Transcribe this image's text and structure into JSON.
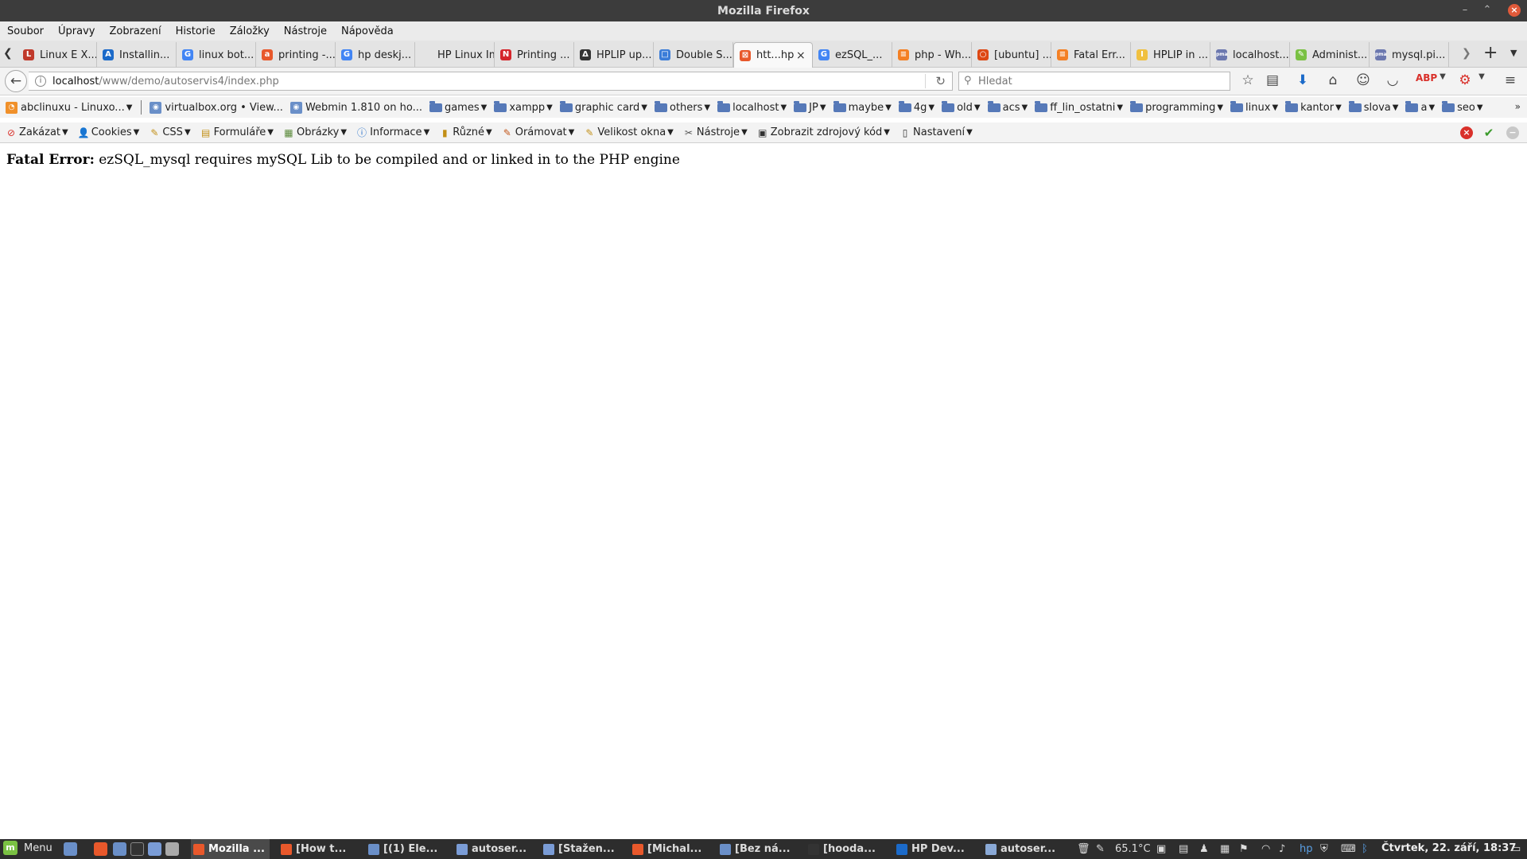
{
  "window": {
    "title": "Mozilla Firefox"
  },
  "menubar": [
    "Soubor",
    "Úpravy",
    "Zobrazení",
    "Historie",
    "Záložky",
    "Nástroje",
    "Nápověda"
  ],
  "tabs": [
    {
      "label": "Linux E X...",
      "color": "#c0392b",
      "glyph": "L"
    },
    {
      "label": "Installin...",
      "color": "#1b6ac9",
      "glyph": "A"
    },
    {
      "label": "linux bot...",
      "color": "#4285f4",
      "glyph": "G"
    },
    {
      "label": "printing -...",
      "color": "#e8582b",
      "glyph": "a"
    },
    {
      "label": "hp deskj...",
      "color": "#4285f4",
      "glyph": "G"
    },
    {
      "label": "HP Linux Im...",
      "color": "#e4e4e4",
      "glyph": ""
    },
    {
      "label": "Printing ...",
      "color": "#d5252b",
      "glyph": "N"
    },
    {
      "label": "HPLIP up...",
      "color": "#333333",
      "glyph": "Δ"
    },
    {
      "label": "Double S...",
      "color": "#3b7dd8",
      "glyph": "□"
    },
    {
      "label": "htt...hp",
      "color": "#e8582b",
      "glyph": "⊠",
      "active": true
    },
    {
      "label": "ezSQL_...",
      "color": "#4285f4",
      "glyph": "G"
    },
    {
      "label": "php - Wh...",
      "color": "#f48024",
      "glyph": "≡"
    },
    {
      "label": "[ubuntu] ...",
      "color": "#dd4814",
      "glyph": "○"
    },
    {
      "label": "Fatal Err...",
      "color": "#f48024",
      "glyph": "≡"
    },
    {
      "label": "HPLIP in ...",
      "color": "#f0c040",
      "glyph": "I"
    },
    {
      "label": "localhost...",
      "color": "#6c78af",
      "glyph": "pma"
    },
    {
      "label": "Administ...",
      "color": "#7ac143",
      "glyph": "✎"
    },
    {
      "label": "mysql.pi...",
      "color": "#6c78af",
      "glyph": "pma"
    }
  ],
  "navbar": {
    "url_host": "localhost",
    "url_path": "/www/demo/autoservis4/index.php",
    "search_placeholder": "Hledat"
  },
  "bookmarks": [
    {
      "label": "abclinuxu - Linuxo...",
      "type": "feed"
    },
    {
      "label": "virtualbox.org • View...",
      "type": "site"
    },
    {
      "label": "Webmin 1.810 on ho...",
      "type": "site"
    },
    {
      "label": "games",
      "type": "folder"
    },
    {
      "label": "xampp",
      "type": "folder"
    },
    {
      "label": "graphic card",
      "type": "folder"
    },
    {
      "label": "others",
      "type": "folder"
    },
    {
      "label": "localhost",
      "type": "folder"
    },
    {
      "label": "JP",
      "type": "folder"
    },
    {
      "label": "maybe",
      "type": "folder"
    },
    {
      "label": "4g",
      "type": "folder"
    },
    {
      "label": "old",
      "type": "folder"
    },
    {
      "label": "acs",
      "type": "folder"
    },
    {
      "label": "ff_lin_ostatni",
      "type": "folder"
    },
    {
      "label": "programming",
      "type": "folder"
    },
    {
      "label": "linux",
      "type": "folder"
    },
    {
      "label": "kantor",
      "type": "folder"
    },
    {
      "label": "slova",
      "type": "folder"
    },
    {
      "label": "a",
      "type": "folder"
    },
    {
      "label": "seo",
      "type": "folder"
    }
  ],
  "devtoolbar": [
    {
      "label": "Zakázat",
      "icon": "⊘",
      "color": "#d9302a"
    },
    {
      "label": "Cookies",
      "icon": "👤",
      "color": "#555555"
    },
    {
      "label": "CSS",
      "icon": "✎",
      "color": "#c28f16"
    },
    {
      "label": "Formuláře",
      "icon": "▤",
      "color": "#c28f16"
    },
    {
      "label": "Obrázky",
      "icon": "▦",
      "color": "#5a8a3a"
    },
    {
      "label": "Informace",
      "icon": "ⓘ",
      "color": "#1b6ac9"
    },
    {
      "label": "Různé",
      "icon": "▮",
      "color": "#c28f16"
    },
    {
      "label": "Orámovat",
      "icon": "✎",
      "color": "#c2561a"
    },
    {
      "label": "Velikost okna",
      "icon": "✎",
      "color": "#c28f16"
    },
    {
      "label": "Nástroje",
      "icon": "✂",
      "color": "#555555"
    },
    {
      "label": "Zobrazit zdrojový kód",
      "icon": "▣",
      "color": "#333333"
    },
    {
      "label": "Nastavení",
      "icon": "▯",
      "color": "#333333"
    }
  ],
  "page": {
    "error_label": "Fatal Error:",
    "error_message": "ezSQL_mysql requires mySQL Lib to be compiled and or linked in to the PHP engine"
  },
  "taskbar": {
    "menu_label": "Menu",
    "tasks": [
      {
        "label": "Mozilla ...",
        "color": "#e8582b",
        "active": true
      },
      {
        "label": "[How t...",
        "color": "#e8582b"
      },
      {
        "label": "[(1) Ele...",
        "color": "#6a8fc8"
      },
      {
        "label": "autoser...",
        "color": "#7a9cd6"
      },
      {
        "label": "[Stažen...",
        "color": "#7a9cd6"
      },
      {
        "label": "[Michal...",
        "color": "#e8582b"
      },
      {
        "label": "[Bez ná...",
        "color": "#6a8fc8"
      },
      {
        "label": "[hooda...",
        "color": "#333333"
      },
      {
        "label": "HP Dev...",
        "color": "#1b6ac9"
      },
      {
        "label": "autoser...",
        "color": "#8aa9d6"
      }
    ],
    "temperature": "65.1°C",
    "clock": "Čtvrtek, 22. září, 18:37"
  }
}
